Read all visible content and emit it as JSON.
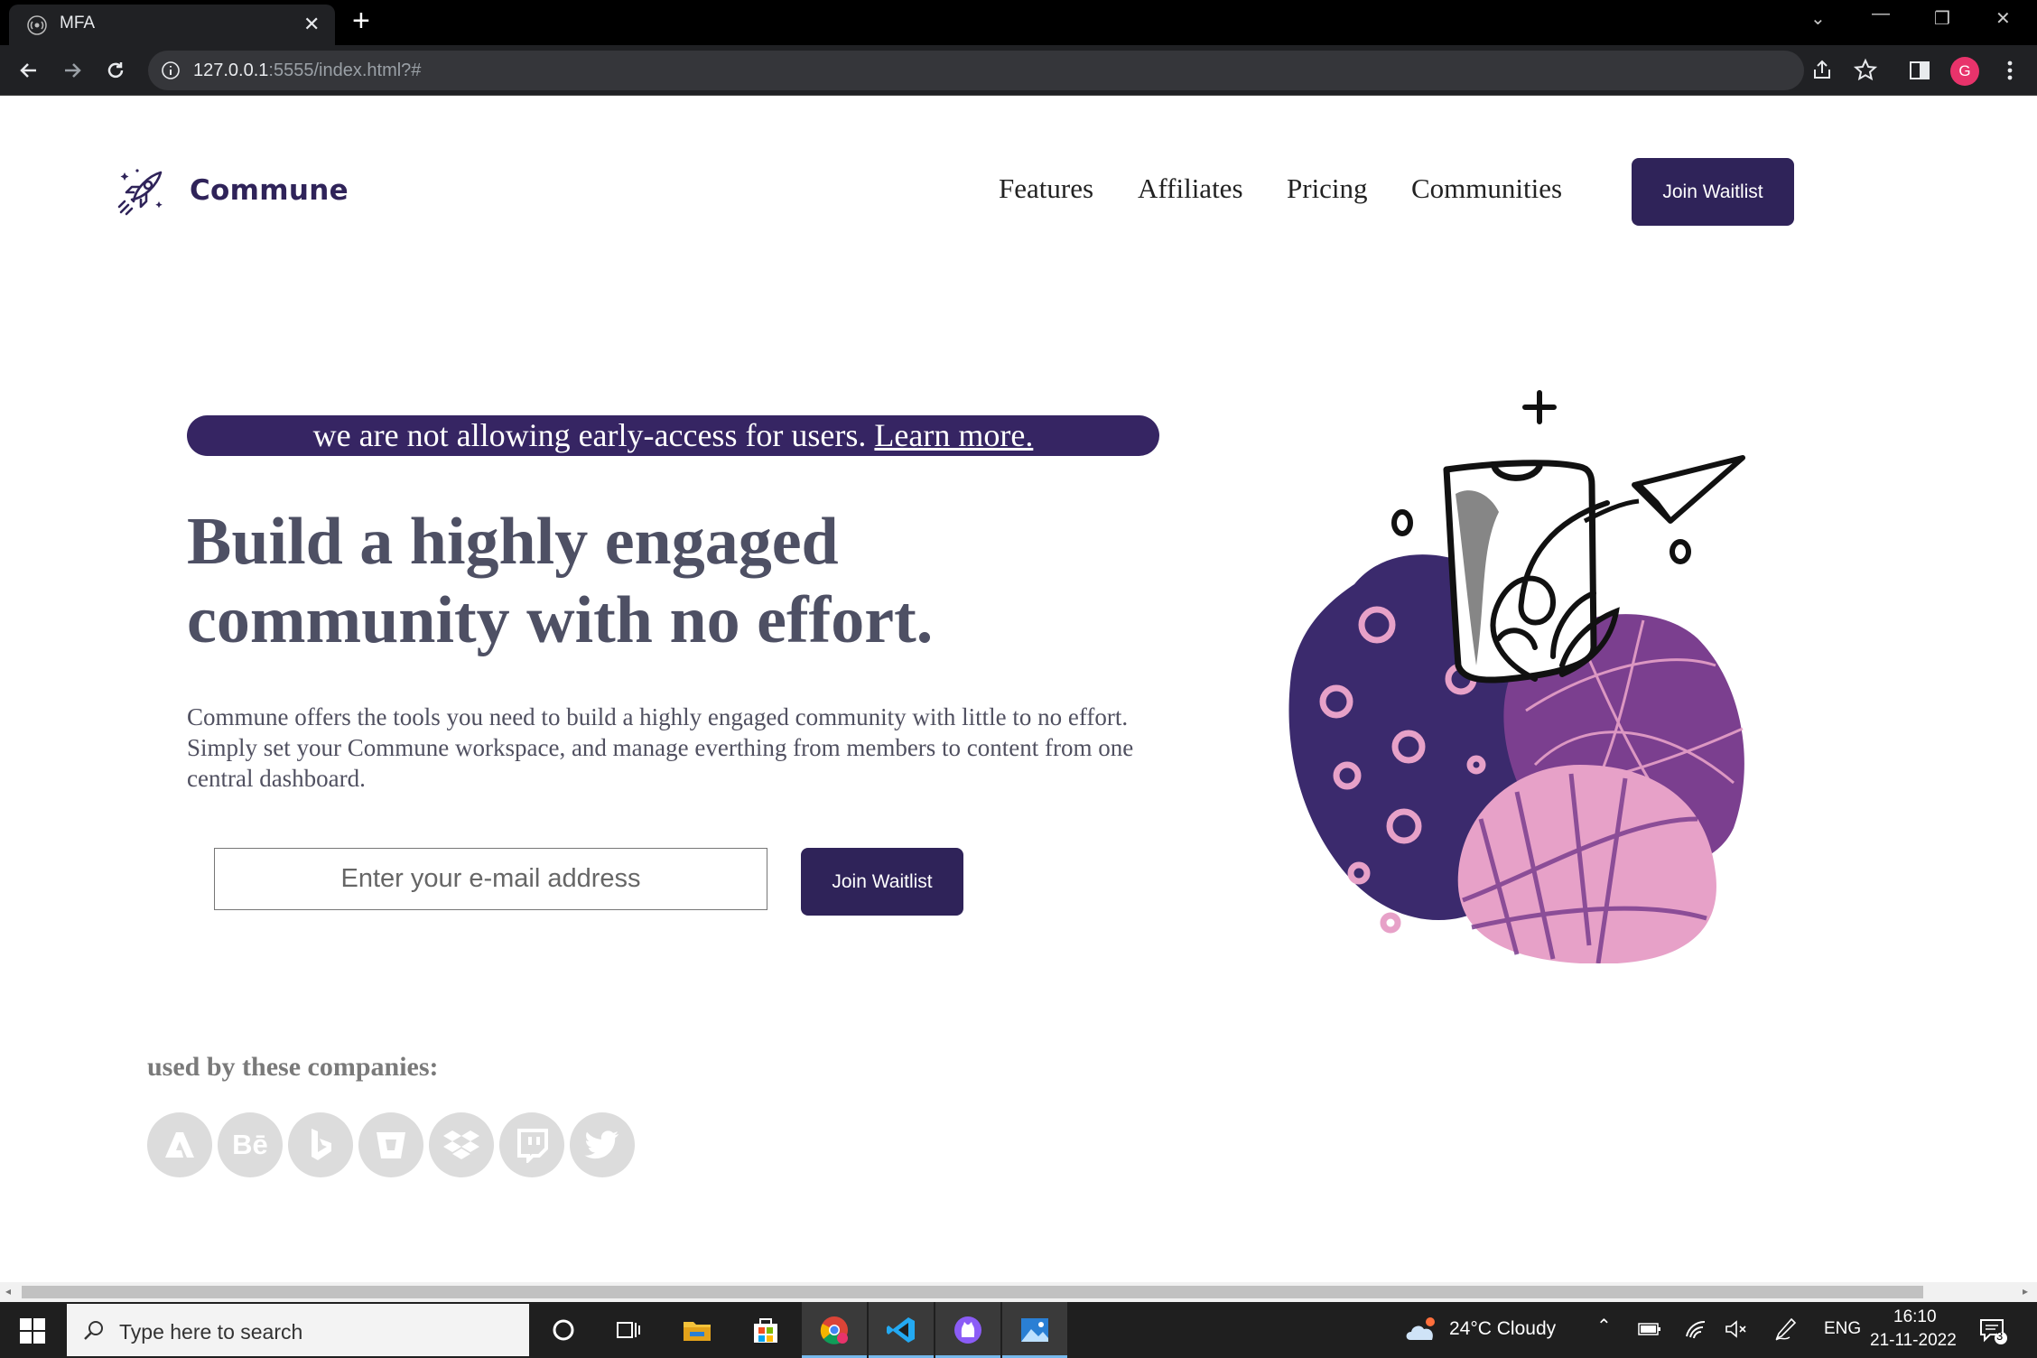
{
  "browser": {
    "tab_title": "MFA",
    "url_host": "127.0.0.1",
    "url_rest": ":5555/index.html?#",
    "profile_initial": "G"
  },
  "site": {
    "brand": "Commune",
    "nav": [
      "Features",
      "Affiliates",
      "Pricing",
      "Communities"
    ],
    "nav_cta": "Join Waitlist",
    "banner_text": "we are not allowing early-access for users. ",
    "banner_link": "Learn more.",
    "headline_line1": "Build a highly engaged",
    "headline_line2": "community with no effort.",
    "subtext": "Commune offers the tools you need to build a highly engaged community with little to no effort. Simply set your Commune workspace, and manage everthing from members to content from one central dashboard.",
    "email_placeholder": "Enter your e-mail address",
    "hero_cta": "Join Waitlist",
    "used_by": "used by these companies:",
    "companies": [
      "adobe",
      "behance",
      "bing",
      "bitbucket",
      "dropbox",
      "twitch",
      "twitter"
    ],
    "behance_mark": "Bē"
  },
  "taskbar": {
    "search_placeholder": "Type here to search",
    "weather": "24°C  Cloudy",
    "lang": "ENG",
    "time": "16:10",
    "date": "21-11-2022",
    "notifications": "3"
  },
  "colors": {
    "brand": "#2f2359",
    "banner": "#362563",
    "purple_dark": "#3b2a6d",
    "purple_mid": "#7b3f8f",
    "pink": "#e7a1c8"
  }
}
